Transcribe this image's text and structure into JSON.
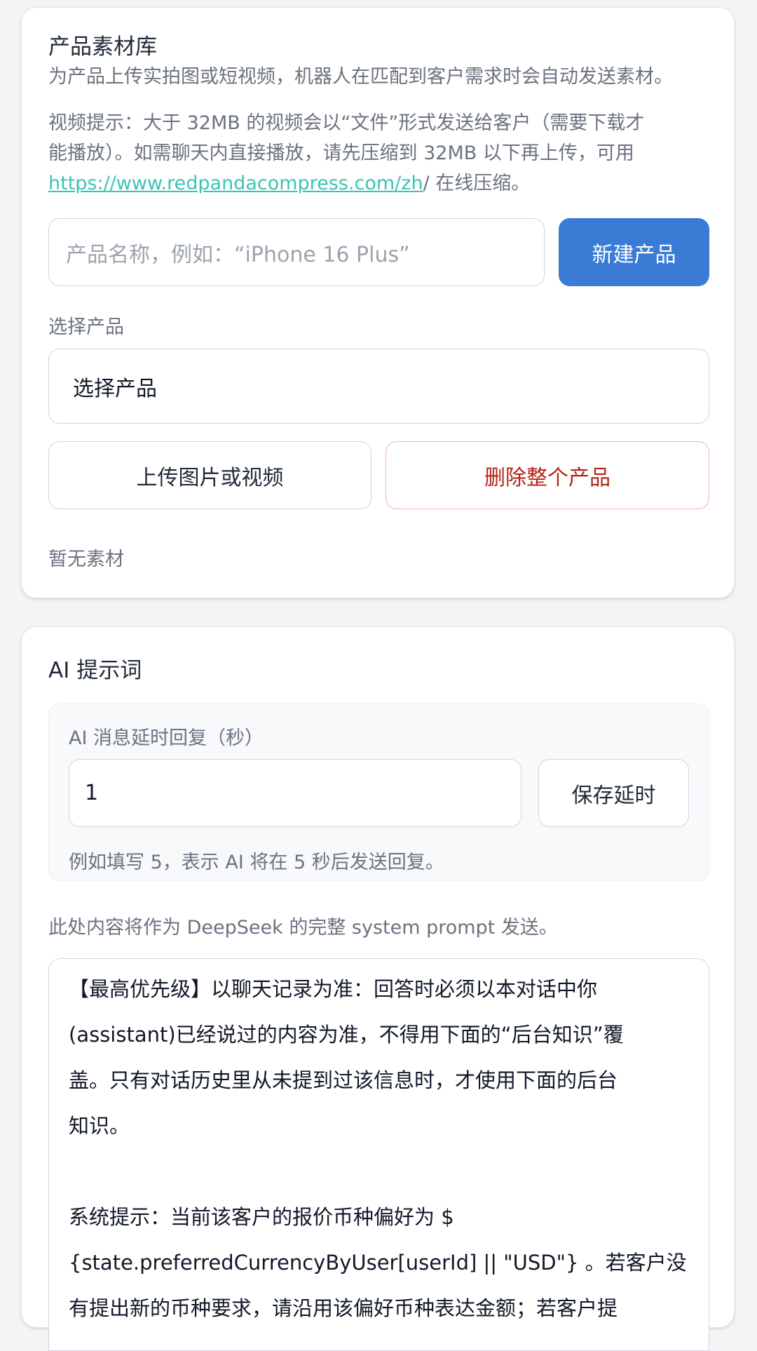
{
  "product_library": {
    "title": "产品素材库",
    "desc_line1": "为产品上传实拍图或短视频，机器人在匹配到客户需求时会自动发送素材。",
    "tip_line1": "视频提示：大于 32MB 的视频会以“文件”形式发送给客户（需要下载才",
    "tip_line2": "能播放）。如需聊天内直接播放，请先压缩到 32MB 以下再上传，可用",
    "tip_link": "https://www.redpandacompress.com/zh",
    "tip_link_suffix": "/ 在线压缩。",
    "name_placeholder": "产品名称，例如：“iPhone 16 Plus”",
    "create_button": "新建产品",
    "select_label": "选择产品",
    "select_value": "选择产品",
    "upload_button": "上传图片或视频",
    "delete_button": "删除整个产品",
    "empty_text": "暂无素材"
  },
  "ai_prompt": {
    "title": "AI 提示词",
    "delay_label": "AI 消息延时回复（秒）",
    "delay_value": "1",
    "save_delay_button": "保存延时",
    "delay_hint": "例如填写 5，表示 AI 将在 5 秒后发送回复。",
    "prompt_note": "此处内容将作为 DeepSeek 的完整 system prompt 发送。",
    "prompt_lines": [
      "【最高优先级】以聊天记录为准：回答时必须以本对话中你",
      "(assistant)已经说过的内容为准，不得用下面的“后台知识”覆",
      "盖。只有对话历史里从未提到过该信息时，才使用下面的后台",
      "知识。",
      "",
      "系统提示：当前该客户的报价币种偏好为 $",
      "{state.preferredCurrencyByUser[userId] || \"USD\"} 。若客户没",
      "有提出新的币种要求，请沿用该偏好币种表达金额；若客户提"
    ]
  }
}
